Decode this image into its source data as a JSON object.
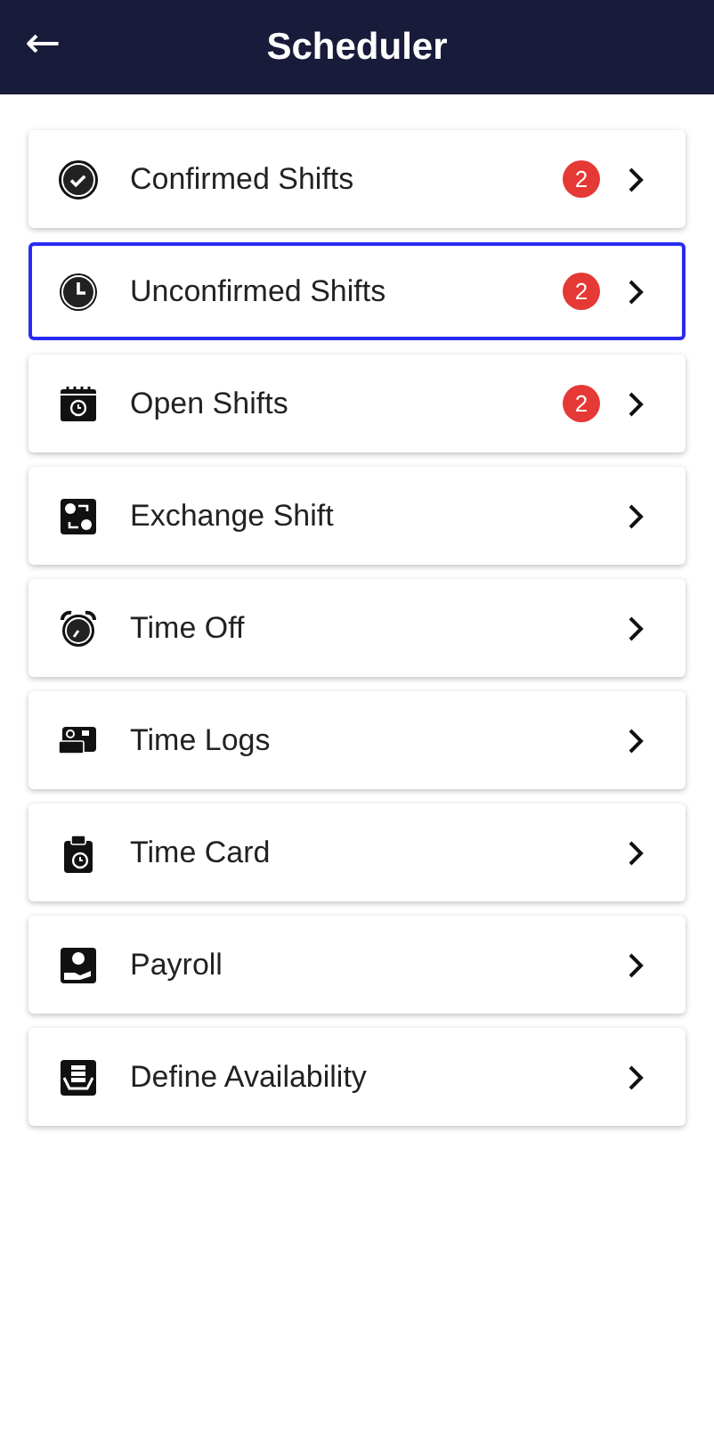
{
  "header": {
    "back": "←",
    "title": "Scheduler"
  },
  "items": [
    {
      "kind": "check",
      "label": "Confirmed Shifts",
      "badge": "2",
      "selected": false
    },
    {
      "kind": "clock",
      "label": "Unconfirmed Shifts",
      "badge": "2",
      "selected": true
    },
    {
      "kind": "calendar",
      "label": "Open Shifts",
      "badge": "2",
      "selected": false
    },
    {
      "kind": "exchange",
      "label": "Exchange Shift",
      "selected": false
    },
    {
      "kind": "alarm",
      "label": "Time Off",
      "selected": false
    },
    {
      "kind": "logs",
      "label": "Time Logs",
      "selected": false
    },
    {
      "kind": "card",
      "label": "Time Card",
      "selected": false
    },
    {
      "kind": "payroll",
      "label": "Payroll",
      "selected": false
    },
    {
      "kind": "availability",
      "label": "Define Availability",
      "selected": false
    }
  ]
}
